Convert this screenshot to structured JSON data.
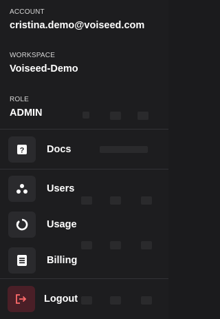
{
  "account": {
    "label": "ACCOUNT",
    "value": "cristina.demo@voiseed.com"
  },
  "workspace": {
    "label": "WORKSPACE",
    "value": "Voiseed-Demo"
  },
  "role": {
    "label": "ROLE",
    "value": "ADMIN"
  },
  "menu_items": [
    {
      "label": "Docs",
      "icon": "docs-icon"
    },
    {
      "label": "Users",
      "icon": "users-icon"
    },
    {
      "label": "Usage",
      "icon": "usage-icon"
    },
    {
      "label": "Billing",
      "icon": "billing-icon"
    },
    {
      "label": "Logout",
      "icon": "logout-icon"
    }
  ],
  "colors": {
    "background": "#1d1d1f",
    "icon_box": "#2a2a2d",
    "logout_box": "#4a1f27",
    "logout_accent": "#ff6b6b"
  }
}
